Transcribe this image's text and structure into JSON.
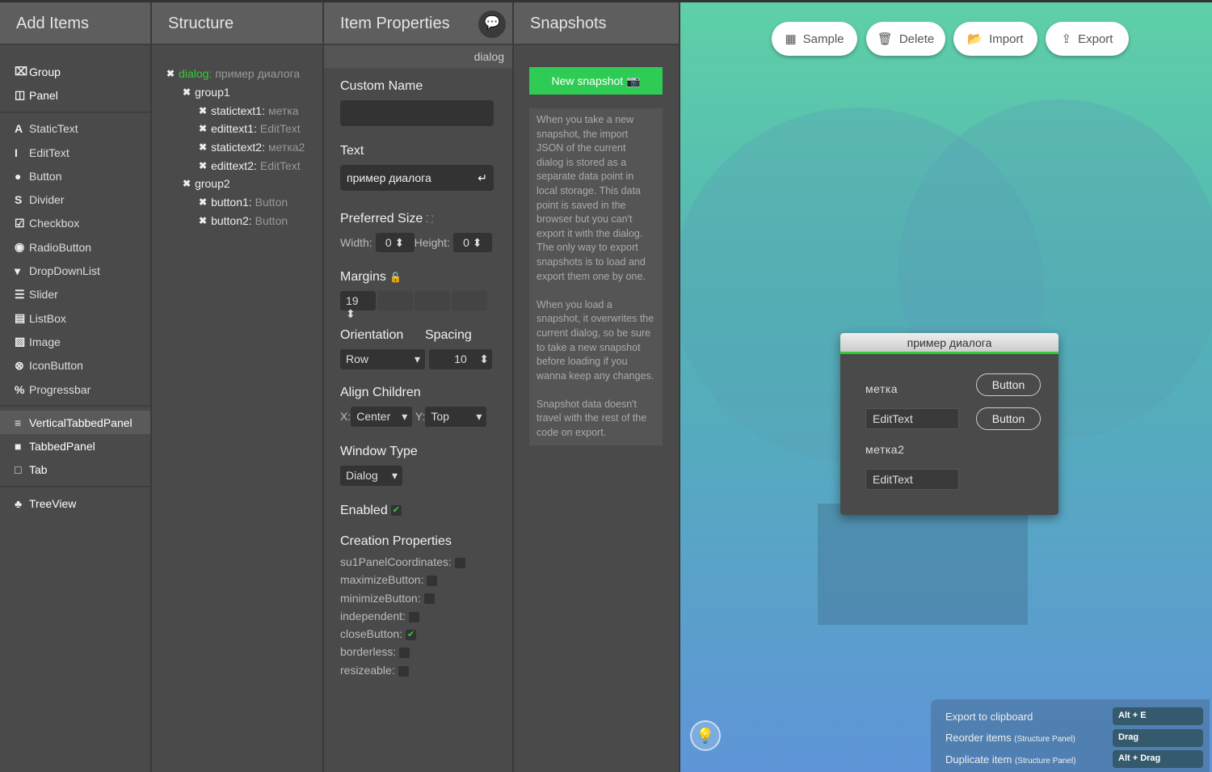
{
  "add_items": {
    "title": "Add Items",
    "groups": [
      [
        {
          "icon": "group-icon",
          "g": "⌧",
          "label": "Group"
        },
        {
          "icon": "panel-icon",
          "g": "◫",
          "label": "Panel"
        }
      ],
      [
        {
          "icon": "statictext-icon",
          "g": "A",
          "label": "StaticText"
        },
        {
          "icon": "edittext-icon",
          "g": "I",
          "label": "EditText"
        },
        {
          "icon": "button-icon",
          "g": "●",
          "label": "Button"
        },
        {
          "icon": "divider-icon",
          "g": "S",
          "label": "Divider"
        },
        {
          "icon": "checkbox-icon",
          "g": "☑",
          "label": "Checkbox"
        },
        {
          "icon": "radio-icon",
          "g": "◉",
          "label": "RadioButton"
        },
        {
          "icon": "dropdown-icon",
          "g": "▾",
          "label": "DropDownList"
        },
        {
          "icon": "slider-icon",
          "g": "☰",
          "label": "Slider"
        },
        {
          "icon": "listbox-icon",
          "g": "▤",
          "label": "ListBox"
        },
        {
          "icon": "image-icon",
          "g": "▨",
          "label": "Image"
        },
        {
          "icon": "iconbutton-icon",
          "g": "⊗",
          "label": "IconButton"
        },
        {
          "icon": "progressbar-icon",
          "g": "%",
          "label": "Progressbar"
        }
      ],
      [
        {
          "icon": "verticaltabbedpanel-icon",
          "g": "≡",
          "label": "VerticalTabbedPanel"
        },
        {
          "icon": "tabbedpanel-icon",
          "g": "■",
          "label": "TabbedPanel"
        },
        {
          "icon": "tab-icon",
          "g": "□",
          "label": "Tab"
        }
      ],
      [
        {
          "icon": "treeview-icon",
          "g": "♣",
          "label": "TreeView"
        }
      ]
    ]
  },
  "structure": {
    "title": "Structure",
    "nodes": [
      {
        "depth": 0,
        "name": "dialog:",
        "value": "пример диалога"
      },
      {
        "depth": 1,
        "name": "group1",
        "value": ""
      },
      {
        "depth": 2,
        "name": "statictext1:",
        "value": "метка"
      },
      {
        "depth": 2,
        "name": "edittext1:",
        "value": "EditText"
      },
      {
        "depth": 2,
        "name": "statictext2:",
        "value": "метка2"
      },
      {
        "depth": 2,
        "name": "edittext2:",
        "value": "EditText"
      },
      {
        "depth": 1,
        "name": "group2",
        "value": ""
      },
      {
        "depth": 2,
        "name": "button1:",
        "value": "Button"
      },
      {
        "depth": 2,
        "name": "button2:",
        "value": "Button"
      }
    ]
  },
  "props": {
    "title": "Item Properties",
    "item_type": "dialog",
    "custom_name_label": "Custom Name",
    "custom_name_value": "",
    "text_label": "Text",
    "text_value": "пример диалога",
    "pref_size_label": "Preferred Size",
    "width_label": "Width:",
    "width": "0",
    "height_label": "Height:",
    "height": "0",
    "margins_label": "Margins",
    "margin": "19",
    "orientation_label": "Orientation",
    "orientation": "Row",
    "spacing_label": "Spacing",
    "spacing": "10",
    "align_label": "Align Children",
    "x_label": "X:",
    "align_x": "Center",
    "y_label": "Y:",
    "align_y": "Top",
    "window_type_label": "Window Type",
    "window_type": "Dialog",
    "enabled_label": "Enabled",
    "enabled": true,
    "creation_label": "Creation Properties",
    "creation": [
      {
        "label": "su1PanelCoordinates:",
        "checked": false
      },
      {
        "label": "maximizeButton:",
        "checked": false
      },
      {
        "label": "minimizeButton:",
        "checked": false
      },
      {
        "label": "independent:",
        "checked": false
      },
      {
        "label": "closeButton:",
        "checked": true
      },
      {
        "label": "borderless:",
        "checked": false
      },
      {
        "label": "resizeable:",
        "checked": false
      }
    ]
  },
  "snapshots": {
    "title": "Snapshots",
    "new_label": "New snapshot",
    "p1": "When you take a new snapshot, the import JSON of the current dialog is stored as a separate data point in local storage. This data point is saved in the browser but you can't export it with the dialog. The only way to export snapshots is to load and export them one by one.",
    "p2": "When you load a snapshot, it overwrites the current dialog, so be sure to take a new snapshot before loading if you wanna keep any changes.",
    "p3": "Snapshot data doesn't travel with the rest of the code on export."
  },
  "toolbar": {
    "sample": "Sample",
    "delete": "Delete",
    "import": "Import",
    "export": "Export"
  },
  "preview": {
    "title": "пример диалога",
    "label1": "метка",
    "edit1": "EditText",
    "label2": "метка2",
    "edit2": "EditText",
    "button1": "Button",
    "button2": "Button"
  },
  "shortcuts": [
    {
      "action": "Export to clipboard",
      "note": "",
      "key": "Alt + E"
    },
    {
      "action": "Reorder items",
      "note": "(Structure Panel)",
      "key": "Drag"
    },
    {
      "action": "Duplicate item",
      "note": "(Structure Panel)",
      "key": "Alt + Drag"
    }
  ]
}
